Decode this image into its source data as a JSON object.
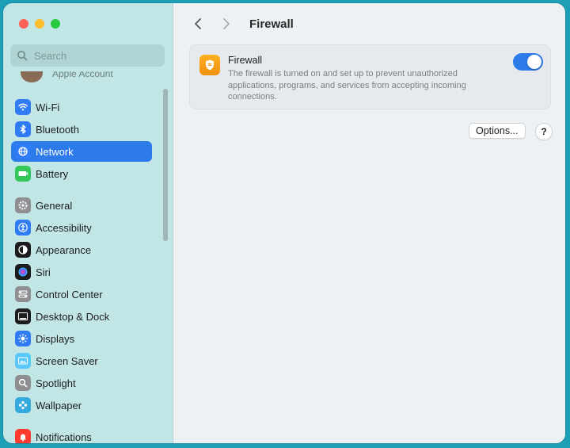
{
  "window": {
    "title": "Firewall"
  },
  "search": {
    "placeholder": "Search"
  },
  "account": {
    "label": "Apple Account"
  },
  "sidebar": {
    "items": [
      {
        "label": "Wi-Fi",
        "icon": "wifi-icon",
        "color": "#2f7cf6"
      },
      {
        "label": "Bluetooth",
        "icon": "bluetooth-icon",
        "color": "#2f7cf6"
      },
      {
        "label": "Network",
        "icon": "globe-icon",
        "color": "#2f7cf6",
        "selected": true
      },
      {
        "label": "Battery",
        "icon": "battery-icon",
        "color": "#34c759"
      },
      {
        "label": "General",
        "icon": "gear-icon",
        "color": "#8e8e93"
      },
      {
        "label": "Accessibility",
        "icon": "accessibility-icon",
        "color": "#2f7cf6"
      },
      {
        "label": "Appearance",
        "icon": "appearance-icon",
        "color": "#1c1c1e"
      },
      {
        "label": "Siri",
        "icon": "siri-icon",
        "color": "#6a3fd6"
      },
      {
        "label": "Control Center",
        "icon": "control-center-icon",
        "color": "#8e8e93"
      },
      {
        "label": "Desktop & Dock",
        "icon": "dock-icon",
        "color": "#1c1c1e"
      },
      {
        "label": "Displays",
        "icon": "displays-icon",
        "color": "#2f7cf6"
      },
      {
        "label": "Screen Saver",
        "icon": "screen-saver-icon",
        "color": "#5ac8fa"
      },
      {
        "label": "Spotlight",
        "icon": "spotlight-icon",
        "color": "#8e8e93"
      },
      {
        "label": "Wallpaper",
        "icon": "wallpaper-icon",
        "color": "#34aadc"
      },
      {
        "label": "Notifications",
        "icon": "notifications-icon",
        "color": "#ff3b30"
      }
    ]
  },
  "firewall": {
    "title": "Firewall",
    "description": "The firewall is turned on and set up to prevent unauthorized applications, programs, and services from accepting incoming connections.",
    "enabled": true
  },
  "buttons": {
    "options": "Options...",
    "help": "?"
  },
  "colors": {
    "accent": "#2d7bea",
    "firewall_icon": "#f59a12"
  }
}
